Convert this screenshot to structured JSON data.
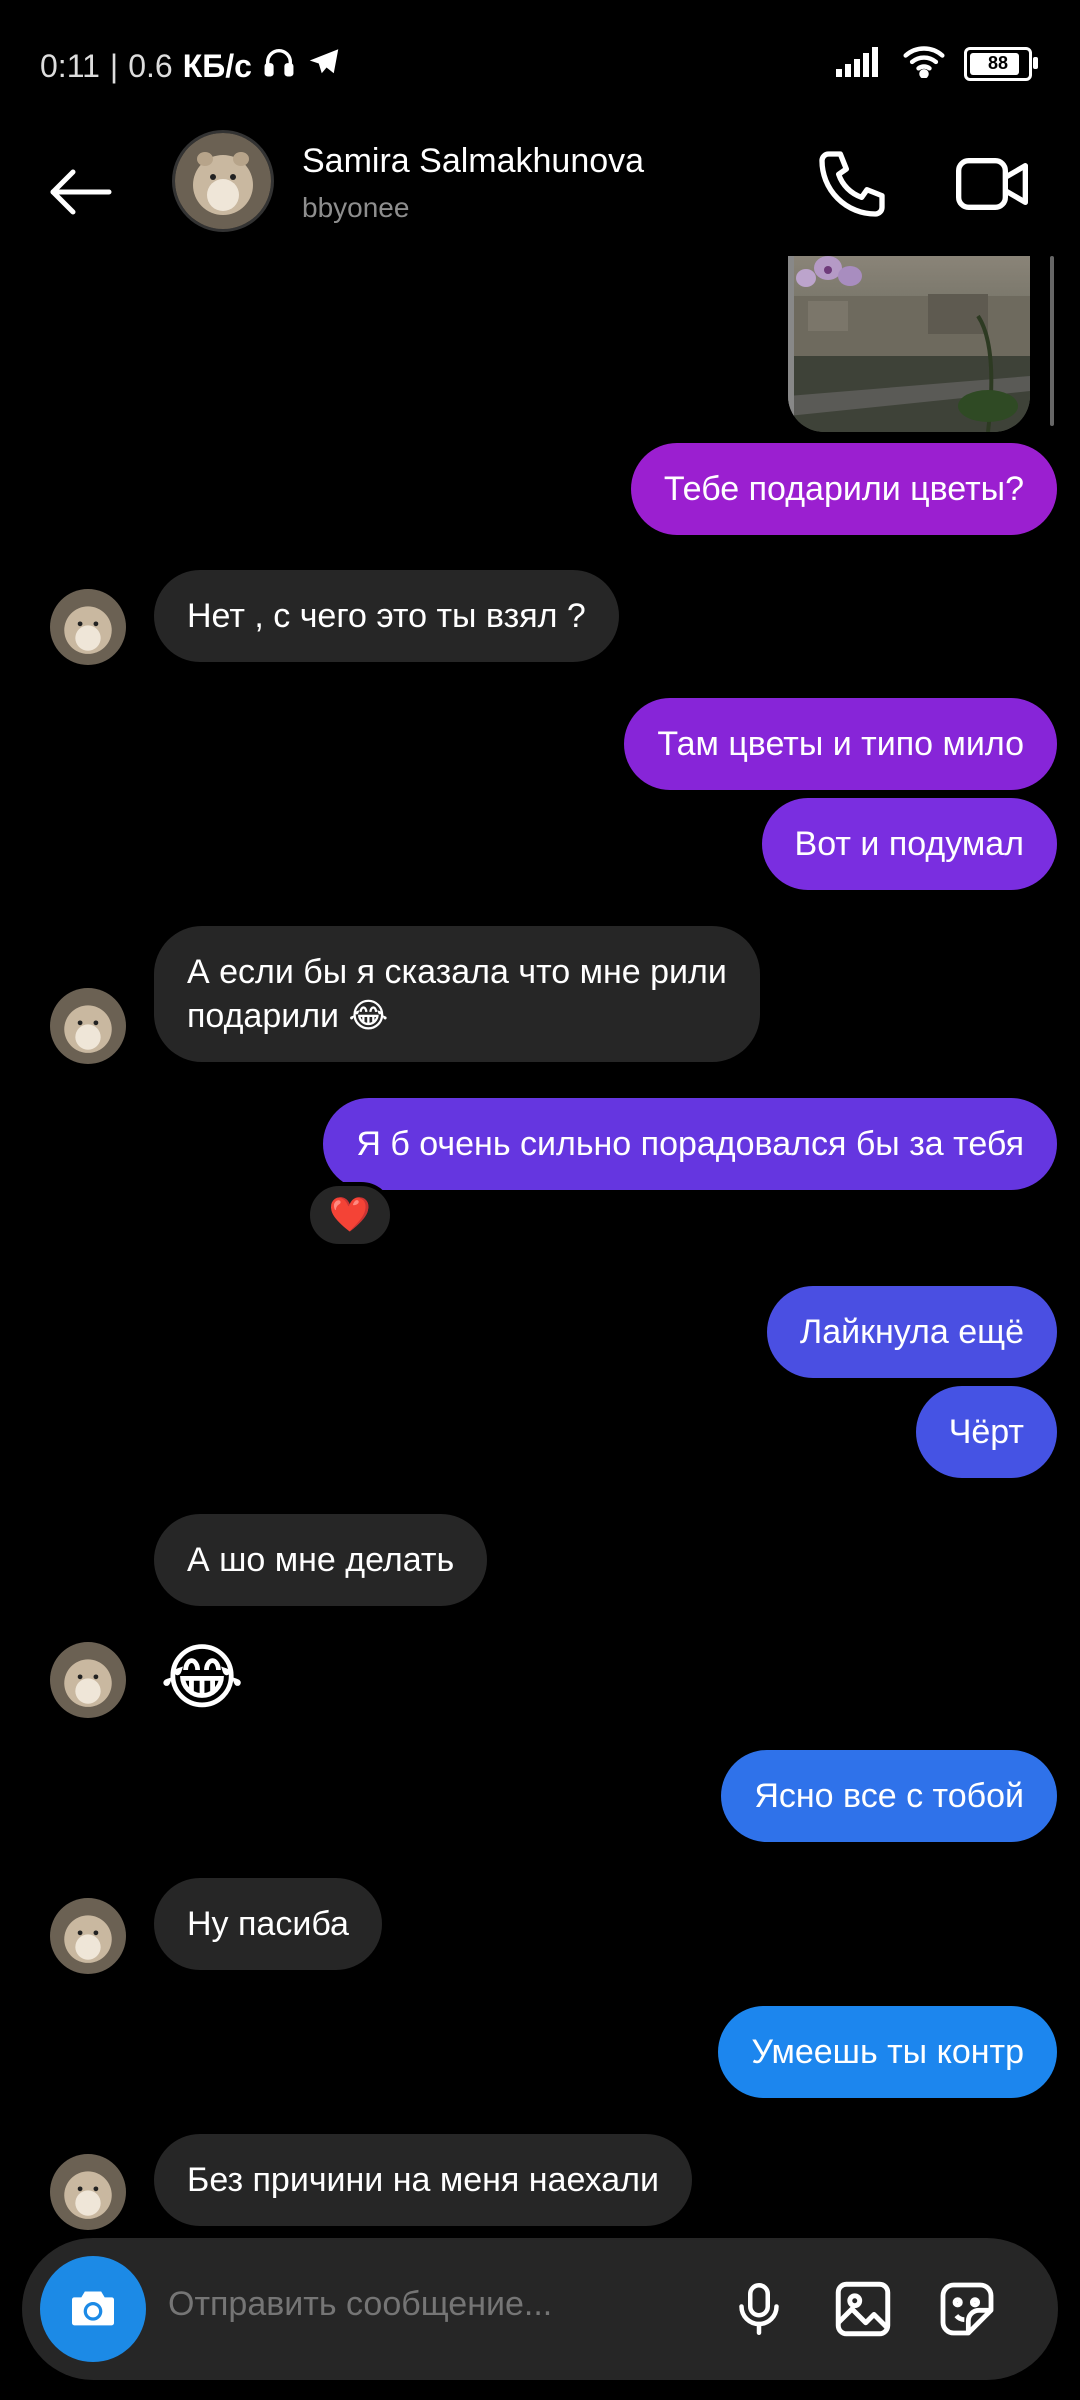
{
  "status_bar": {
    "time": "0:11",
    "speed": "0.6",
    "speed_unit": "КБ/с",
    "battery": "88"
  },
  "header": {
    "name": "Samira Salmakhunova",
    "username": "bbyonee"
  },
  "messages": [
    {
      "side": "out",
      "text": "Тебе подарили цветы?"
    },
    {
      "side": "in",
      "text": "Нет , с чего это ты взял ?"
    },
    {
      "side": "out",
      "text": "Там цветы и типо мило"
    },
    {
      "side": "out",
      "text": "Вот и подумал"
    },
    {
      "side": "in",
      "line1": "А если бы я сказала что мне рили",
      "line2": "подарили 😂"
    },
    {
      "side": "out",
      "text": "Я б очень сильно порадовался бы за тебя",
      "reaction": "❤️"
    },
    {
      "side": "out",
      "text": "Лайкнула ещё"
    },
    {
      "side": "out",
      "text": "Чёрт"
    },
    {
      "side": "in",
      "text": "А шо мне делать"
    },
    {
      "side": "in",
      "text": "😂"
    },
    {
      "side": "out",
      "text": "Ясно все с тобой"
    },
    {
      "side": "in",
      "text": "Ну пасиба"
    },
    {
      "side": "out",
      "text": "Умеешь ты контр"
    },
    {
      "side": "in",
      "text": "Без причини на меня наехали"
    }
  ],
  "composer": {
    "placeholder": "Отправить сообщение..."
  },
  "colors": {
    "background": "#000000",
    "incoming_bubble": "#262626",
    "outgoing_gradient": [
      "#9b1fd0",
      "#7a2ee0",
      "#5a45e0",
      "#3b66e8",
      "#1c86ee"
    ],
    "camera_button": "#1c8ae6"
  },
  "icons": [
    "back-arrow-icon",
    "phone-icon",
    "video-camera-icon",
    "camera-icon",
    "microphone-icon",
    "gallery-icon",
    "sticker-icon",
    "wifi-icon",
    "signal-icon",
    "headphones-icon",
    "telegram-icon",
    "battery-icon"
  ]
}
